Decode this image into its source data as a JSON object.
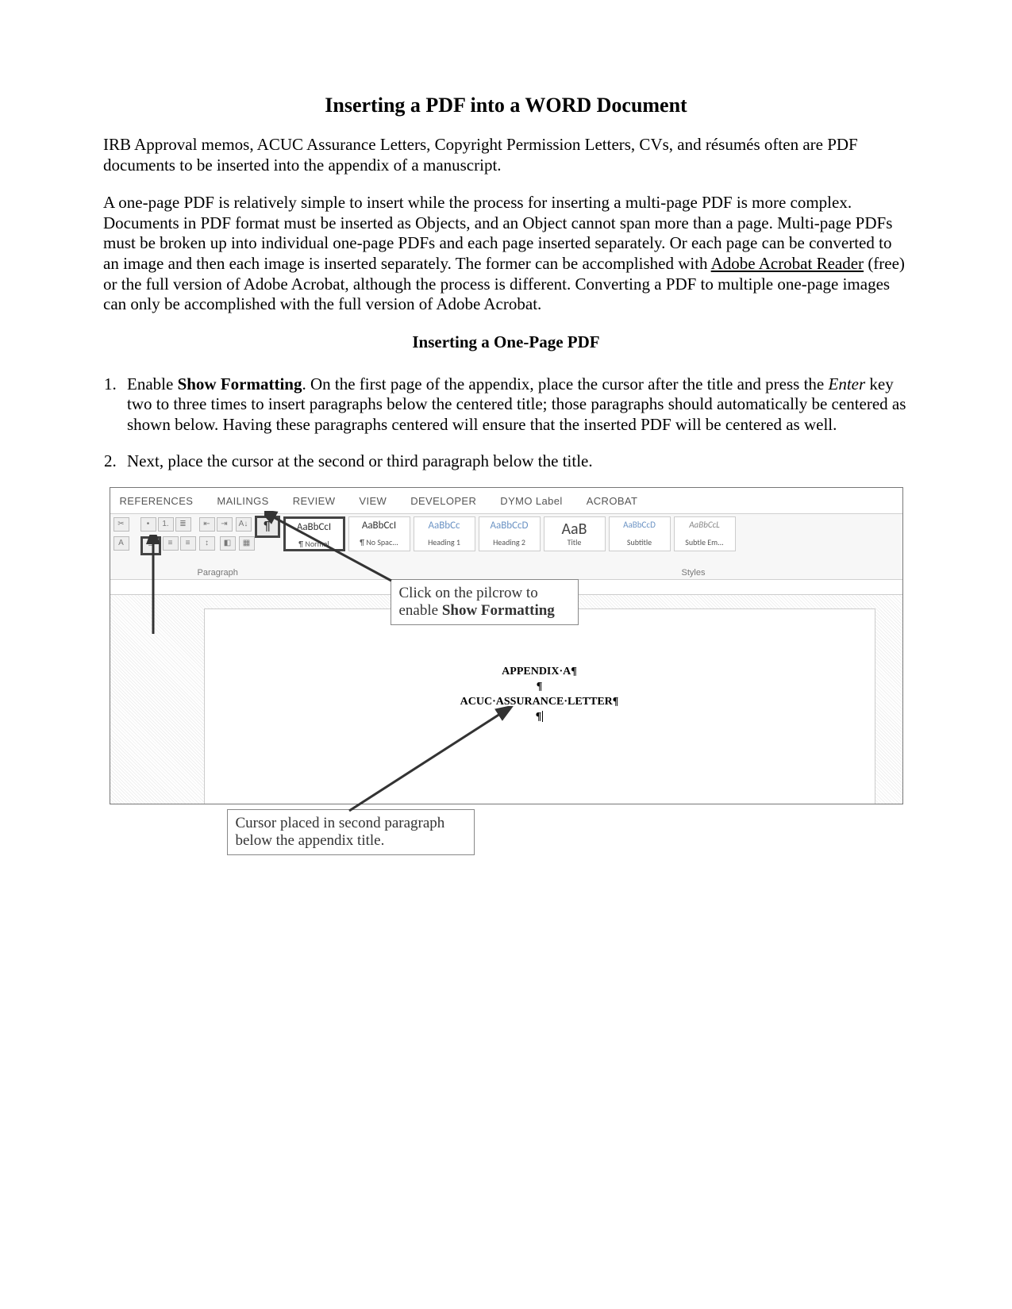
{
  "title": "Inserting a PDF into a WORD Document",
  "intro1": "IRB Approval memos, ACUC Assurance Letters, Copyright Permission Letters, CVs, and résumés often are PDF documents to be inserted into the appendix of a manuscript.",
  "intro2_a": "A one-page PDF is relatively simple to insert while the process for inserting a multi-page PDF is more complex. Documents in PDF format must be inserted as Objects, and an Object cannot span more than a page. Multi-page PDFs must be broken up into individual one-page PDFs and each page inserted separately. Or each page can be converted to an image and then each image is inserted separately. The former can be accomplished with ",
  "intro2_link": "Adobe Acrobat Reader",
  "intro2_b": " (free) or the full version of Adobe Acrobat, although the process is different. Converting a PDF to multiple one-page images can only be accomplished with the full version of Adobe Acrobat.",
  "subhead": "Inserting a One-Page PDF",
  "step1_a": "Enable ",
  "step1_b": "Show Formatting",
  "step1_c": ". On the first page of the appendix, place the cursor after the title and press the ",
  "step1_d": "Enter",
  "step1_e": " key two to three times to insert paragraphs below the centered title; those paragraphs should automatically be centered as shown below. Having these paragraphs centered will ensure that the inserted PDF will be centered as well.",
  "step2": "Next, place the cursor at the second or third paragraph below the title.",
  "ribbon": {
    "tabs": [
      "REFERENCES",
      "MAILINGS",
      "REVIEW",
      "VIEW",
      "DEVELOPER",
      "DYMO Label",
      "ACROBAT"
    ],
    "paragraph_group": "Paragraph",
    "styles_group": "Styles",
    "styles": [
      {
        "sample": "AaBbCcI",
        "label": "¶ Normal"
      },
      {
        "sample": "AaBbCcI",
        "label": "¶ No Spac..."
      },
      {
        "sample": "AaBbCc",
        "label": "Heading 1"
      },
      {
        "sample": "AaBbCcD",
        "label": "Heading 2"
      },
      {
        "sample": "AaB",
        "label": "Title"
      },
      {
        "sample": "AaBbCcD",
        "label": "Subtitle"
      },
      {
        "sample": "AaBbCcL",
        "label": "Subtle Em..."
      }
    ]
  },
  "doc": {
    "line1": "APPENDIX·A¶",
    "line2": "¶",
    "line3": "ACUC·ASSURANCE·LETTER¶",
    "line4": "¶"
  },
  "callout1_a": "Click on the pilcrow to enable ",
  "callout1_b": "Show Formatting",
  "callout2": "Cursor placed in second paragraph below the appendix title."
}
